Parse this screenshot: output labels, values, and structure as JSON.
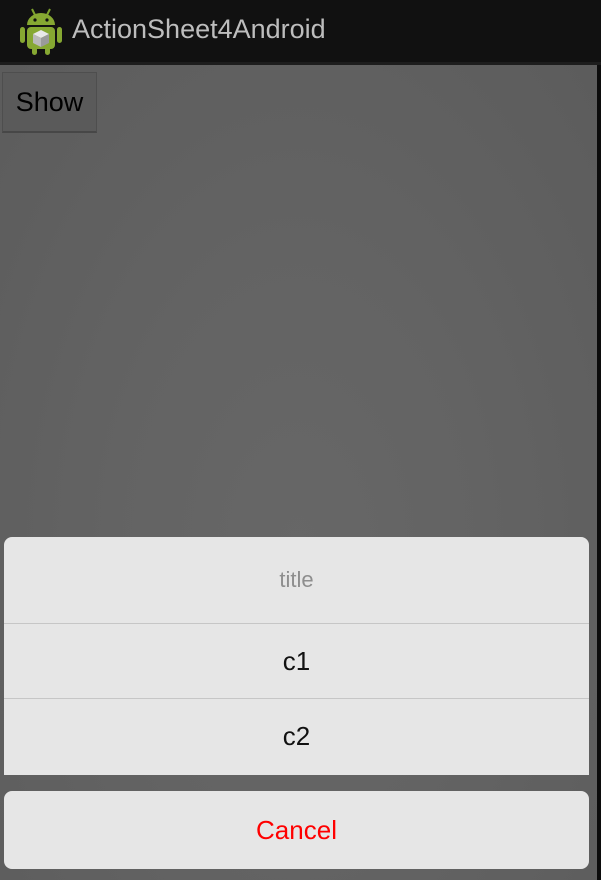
{
  "action_bar": {
    "title": "ActionSheet4Android",
    "icon": "android-robot-icon"
  },
  "main": {
    "show_button_label": "Show"
  },
  "action_sheet": {
    "title": "title",
    "items": [
      {
        "label": "c1"
      },
      {
        "label": "c2"
      }
    ],
    "cancel_label": "Cancel",
    "cancel_color": "#ff0000"
  }
}
